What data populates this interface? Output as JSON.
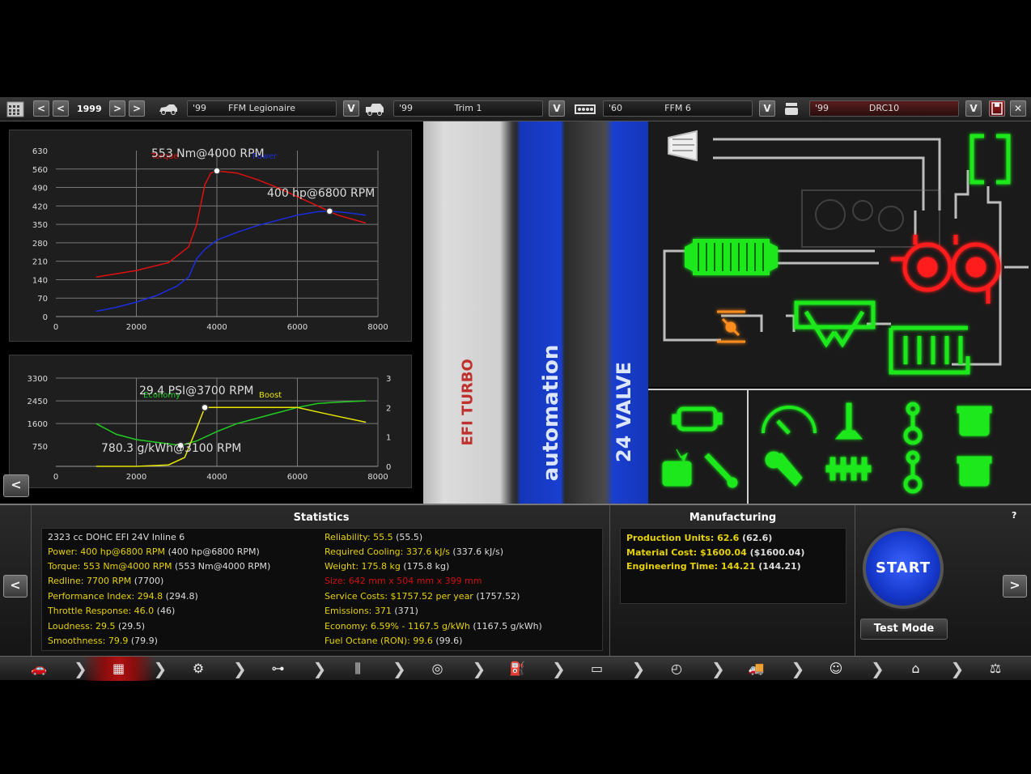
{
  "toolbar": {
    "year": "1999",
    "car_model": {
      "year": "'99",
      "name": "FFM Legionaire"
    },
    "car_trim": {
      "year": "'99",
      "name": "Trim 1"
    },
    "engine_family": {
      "year": "'60",
      "name": "FFM 6"
    },
    "engine_variant": {
      "year": "'99",
      "name": "DRC10"
    },
    "prev_label": "<",
    "next_label": ">",
    "dropdown_label": "V"
  },
  "chart_power": {
    "annotation_torque": "553 Nm@4000 RPM",
    "annotation_power": "400 hp@6800 RPM",
    "legend_torque": "Torque",
    "legend_power": "Power",
    "colors": {
      "torque": "#e01010",
      "power": "#1a2ee0"
    }
  },
  "chart_economy": {
    "annotation_boost": "29.4 PSI@3700 RPM",
    "annotation_economy": "780.3 g/kWh@3100 RPM",
    "legend_economy": "Economy",
    "legend_boost": "Boost",
    "colors": {
      "economy": "#22cc22",
      "boost": "#e6e600"
    }
  },
  "chart_data": [
    {
      "type": "line",
      "xlim": [
        0,
        8000
      ],
      "ylim": [
        0,
        630
      ],
      "x_ticks": [
        "0",
        "2000",
        "4000",
        "6000",
        "8000"
      ],
      "y_ticks": [
        "0",
        "70",
        "140",
        "210",
        "280",
        "350",
        "420",
        "490",
        "560",
        "630"
      ],
      "series": [
        {
          "name": "Torque",
          "x": [
            1000,
            2000,
            2800,
            3300,
            3500,
            3700,
            3850,
            4000,
            4500,
            5000,
            5500,
            6000,
            6500,
            7000,
            7700
          ],
          "y": [
            150,
            175,
            205,
            265,
            350,
            500,
            545,
            553,
            545,
            520,
            490,
            455,
            420,
            385,
            355
          ]
        },
        {
          "name": "Power",
          "x": [
            1000,
            1500,
            2000,
            2500,
            3000,
            3300,
            3500,
            3700,
            4000,
            4500,
            5000,
            5500,
            6000,
            6500,
            6800,
            7200,
            7700
          ],
          "y": [
            20,
            35,
            55,
            80,
            115,
            150,
            220,
            255,
            290,
            320,
            345,
            365,
            385,
            398,
            400,
            395,
            385
          ]
        }
      ]
    },
    {
      "type": "line",
      "xlim": [
        0,
        8000
      ],
      "ylim": [
        0,
        3300
      ],
      "y2lim": [
        0,
        3
      ],
      "x_ticks": [
        "0",
        "2000",
        "4000",
        "6000",
        "8000"
      ],
      "y_ticks": [
        "750",
        "1600",
        "2450",
        "3300"
      ],
      "y2_ticks": [
        "0",
        "1",
        "2",
        "3"
      ],
      "series": [
        {
          "name": "Economy",
          "x": [
            1000,
            1500,
            2000,
            2500,
            3100,
            3500,
            4000,
            4500,
            5000,
            5500,
            6000,
            6500,
            7000,
            7700
          ],
          "y": [
            1600,
            1200,
            1000,
            900,
            780.3,
            950,
            1300,
            1600,
            1800,
            2000,
            2200,
            2350,
            2400,
            2450
          ]
        },
        {
          "name": "Boost",
          "x": [
            1000,
            2000,
            2800,
            3200,
            3500,
            3700,
            4000,
            5000,
            6000,
            6500,
            7000,
            7700
          ],
          "y": [
            0,
            0,
            0.05,
            0.3,
            1.3,
            2.0,
            2.0,
            2.0,
            2.0,
            1.85,
            1.7,
            1.5
          ]
        }
      ]
    }
  ],
  "photo": {
    "efi_label": "EFI TURBO",
    "brand_label": "automation",
    "valve_label": "24 VALVE"
  },
  "statistics": {
    "title": "Statistics",
    "left": [
      {
        "label": "2323 cc DOHC EFI 24V Inline 6",
        "paren": ""
      },
      {
        "label": "Power: 400 hp@6800 RPM",
        "paren": "(400 hp@6800 RPM)"
      },
      {
        "label": "Torque: 553 Nm@4000 RPM",
        "paren": "(553 Nm@4000 RPM)"
      },
      {
        "label": "Redline: 7700 RPM",
        "paren": "(7700)"
      },
      {
        "label": "Performance Index: 294.8",
        "paren": "(294.8)"
      },
      {
        "label": "Throttle Response: 46.0",
        "paren": "(46)"
      },
      {
        "label": "Loudness: 29.5",
        "paren": "(29.5)"
      },
      {
        "label": "Smoothness: 79.9",
        "paren": "(79.9)"
      }
    ],
    "right": [
      {
        "label": "Reliability: 55.5",
        "paren": "(55.5)"
      },
      {
        "label": "Required Cooling: 337.6 kJ/s",
        "paren": "(337.6 kJ/s)"
      },
      {
        "label": "Weight: 175.8 kg",
        "paren": "(175.8 kg)"
      },
      {
        "label": "Size: 642 mm x 504 mm x 399 mm",
        "paren": ""
      },
      {
        "label": "Service Costs: $1757.52 per year",
        "paren": "(1757.52)"
      },
      {
        "label": "Emissions: 371",
        "paren": "(371)"
      },
      {
        "label": "Economy: 6.59% - 1167.5 g/kWh",
        "paren": "(1167.5 g/kWh)"
      },
      {
        "label": "Fuel Octane (RON): 99.6",
        "paren": "(99.6)"
      }
    ]
  },
  "manufacturing": {
    "title": "Manufacturing",
    "lines": [
      {
        "label": "Production Units: 62.6",
        "paren": "(62.6)"
      },
      {
        "label": "Material Cost: $1600.04",
        "paren": "($1600.04)"
      },
      {
        "label": "Engineering Time: 144.21",
        "paren": "(144.21)"
      }
    ]
  },
  "controls": {
    "start": "START",
    "test_mode": "Test Mode",
    "help": "?",
    "back": "<",
    "left": "<",
    "right": ">"
  },
  "nav": [
    {
      "icon": "car-body-icon",
      "glyph": "🚗"
    },
    {
      "icon": "engine-block-icon",
      "glyph": "▦"
    },
    {
      "icon": "bottom-end-icon",
      "glyph": "⚙"
    },
    {
      "icon": "top-end-icon",
      "glyph": "⊶"
    },
    {
      "icon": "camshaft-icon",
      "glyph": "⫼"
    },
    {
      "icon": "turbo-icon",
      "glyph": "◎"
    },
    {
      "icon": "fuel-system-icon",
      "glyph": "⛽"
    },
    {
      "icon": "exhaust-icon",
      "glyph": "▭"
    },
    {
      "icon": "engine-tuning-icon",
      "glyph": "◴"
    },
    {
      "icon": "car-test-icon",
      "glyph": "🚚"
    },
    {
      "icon": "engineering-icon",
      "glyph": "☺"
    },
    {
      "icon": "factory-icon",
      "glyph": "⌂"
    },
    {
      "icon": "market-icon",
      "glyph": "⚖"
    }
  ]
}
